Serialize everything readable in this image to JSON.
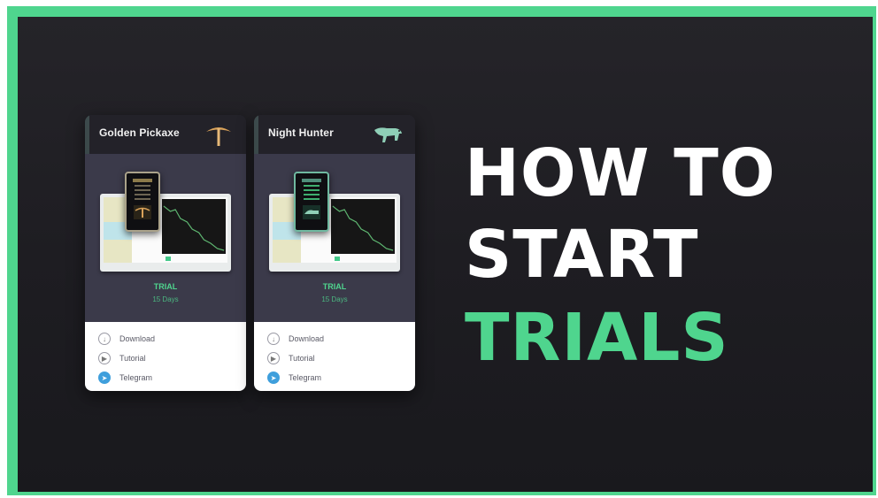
{
  "theme": {
    "accent": "#4fd58e",
    "background": "#1e1d22",
    "card_body": "#3b3a4a",
    "telegram": "#3f9fdc"
  },
  "headline": {
    "line1": "HOW TO",
    "line2": "START",
    "line3": "TRIALS"
  },
  "cards": [
    {
      "title": "Golden Pickaxe",
      "logo_icon": "pickaxe-icon",
      "trial_label": "TRIAL",
      "trial_sub": "15 Days",
      "menu": [
        {
          "label": "Download",
          "icon": "download-icon"
        },
        {
          "label": "Tutorial",
          "icon": "tutorial-icon"
        },
        {
          "label": "Telegram",
          "icon": "telegram-icon"
        }
      ]
    },
    {
      "title": "Night Hunter",
      "logo_icon": "panther-icon",
      "trial_label": "TRIAL",
      "trial_sub": "15 Days",
      "menu": [
        {
          "label": "Download",
          "icon": "download-icon"
        },
        {
          "label": "Tutorial",
          "icon": "tutorial-icon"
        },
        {
          "label": "Telegram",
          "icon": "telegram-icon"
        }
      ]
    }
  ]
}
